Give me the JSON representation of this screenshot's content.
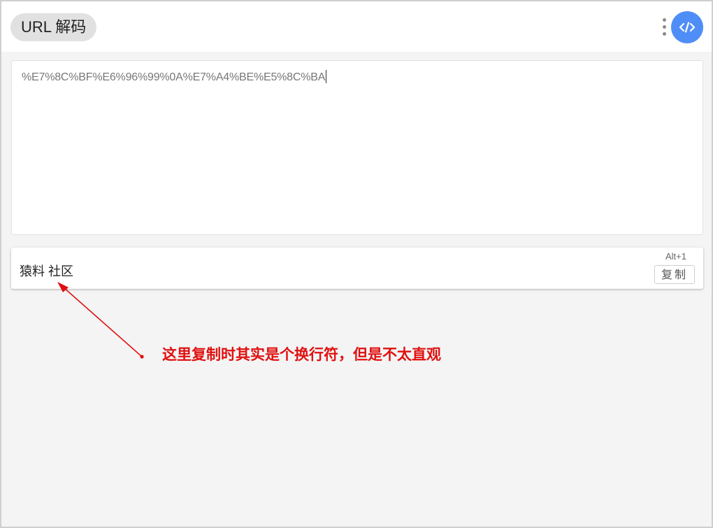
{
  "header": {
    "title": "URL 解码",
    "menu_icon": "vertical-dots-icon",
    "tool_icon": "code-icon",
    "accent_color": "#4f8ef7"
  },
  "input": {
    "value": "%E7%8C%BF%E6%96%99%0A%E7%A4%BE%E5%8C%BA"
  },
  "output": {
    "text": "猿料 社区",
    "shortcut": "Alt+1",
    "copy_label": "复制"
  },
  "annotation": {
    "text": "这里复制时其实是个换行符，但是不太直观",
    "color": "#e01010"
  }
}
